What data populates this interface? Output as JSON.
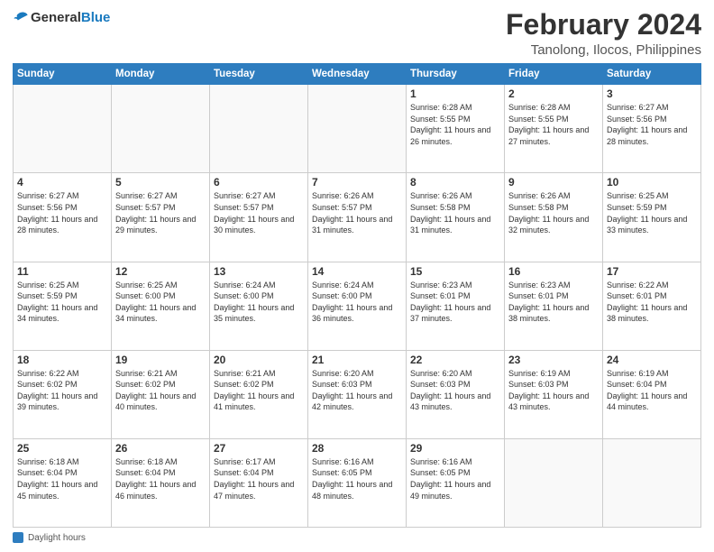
{
  "header": {
    "logo_general": "General",
    "logo_blue": "Blue",
    "title": "February 2024",
    "subtitle": "Tanolong, Ilocos, Philippines"
  },
  "days_of_week": [
    "Sunday",
    "Monday",
    "Tuesday",
    "Wednesday",
    "Thursday",
    "Friday",
    "Saturday"
  ],
  "weeks": [
    [
      {
        "day": "",
        "info": ""
      },
      {
        "day": "",
        "info": ""
      },
      {
        "day": "",
        "info": ""
      },
      {
        "day": "",
        "info": ""
      },
      {
        "day": "1",
        "info": "Sunrise: 6:28 AM\nSunset: 5:55 PM\nDaylight: 11 hours and 26 minutes."
      },
      {
        "day": "2",
        "info": "Sunrise: 6:28 AM\nSunset: 5:55 PM\nDaylight: 11 hours and 27 minutes."
      },
      {
        "day": "3",
        "info": "Sunrise: 6:27 AM\nSunset: 5:56 PM\nDaylight: 11 hours and 28 minutes."
      }
    ],
    [
      {
        "day": "4",
        "info": "Sunrise: 6:27 AM\nSunset: 5:56 PM\nDaylight: 11 hours and 28 minutes."
      },
      {
        "day": "5",
        "info": "Sunrise: 6:27 AM\nSunset: 5:57 PM\nDaylight: 11 hours and 29 minutes."
      },
      {
        "day": "6",
        "info": "Sunrise: 6:27 AM\nSunset: 5:57 PM\nDaylight: 11 hours and 30 minutes."
      },
      {
        "day": "7",
        "info": "Sunrise: 6:26 AM\nSunset: 5:57 PM\nDaylight: 11 hours and 31 minutes."
      },
      {
        "day": "8",
        "info": "Sunrise: 6:26 AM\nSunset: 5:58 PM\nDaylight: 11 hours and 31 minutes."
      },
      {
        "day": "9",
        "info": "Sunrise: 6:26 AM\nSunset: 5:58 PM\nDaylight: 11 hours and 32 minutes."
      },
      {
        "day": "10",
        "info": "Sunrise: 6:25 AM\nSunset: 5:59 PM\nDaylight: 11 hours and 33 minutes."
      }
    ],
    [
      {
        "day": "11",
        "info": "Sunrise: 6:25 AM\nSunset: 5:59 PM\nDaylight: 11 hours and 34 minutes."
      },
      {
        "day": "12",
        "info": "Sunrise: 6:25 AM\nSunset: 6:00 PM\nDaylight: 11 hours and 34 minutes."
      },
      {
        "day": "13",
        "info": "Sunrise: 6:24 AM\nSunset: 6:00 PM\nDaylight: 11 hours and 35 minutes."
      },
      {
        "day": "14",
        "info": "Sunrise: 6:24 AM\nSunset: 6:00 PM\nDaylight: 11 hours and 36 minutes."
      },
      {
        "day": "15",
        "info": "Sunrise: 6:23 AM\nSunset: 6:01 PM\nDaylight: 11 hours and 37 minutes."
      },
      {
        "day": "16",
        "info": "Sunrise: 6:23 AM\nSunset: 6:01 PM\nDaylight: 11 hours and 38 minutes."
      },
      {
        "day": "17",
        "info": "Sunrise: 6:22 AM\nSunset: 6:01 PM\nDaylight: 11 hours and 38 minutes."
      }
    ],
    [
      {
        "day": "18",
        "info": "Sunrise: 6:22 AM\nSunset: 6:02 PM\nDaylight: 11 hours and 39 minutes."
      },
      {
        "day": "19",
        "info": "Sunrise: 6:21 AM\nSunset: 6:02 PM\nDaylight: 11 hours and 40 minutes."
      },
      {
        "day": "20",
        "info": "Sunrise: 6:21 AM\nSunset: 6:02 PM\nDaylight: 11 hours and 41 minutes."
      },
      {
        "day": "21",
        "info": "Sunrise: 6:20 AM\nSunset: 6:03 PM\nDaylight: 11 hours and 42 minutes."
      },
      {
        "day": "22",
        "info": "Sunrise: 6:20 AM\nSunset: 6:03 PM\nDaylight: 11 hours and 43 minutes."
      },
      {
        "day": "23",
        "info": "Sunrise: 6:19 AM\nSunset: 6:03 PM\nDaylight: 11 hours and 43 minutes."
      },
      {
        "day": "24",
        "info": "Sunrise: 6:19 AM\nSunset: 6:04 PM\nDaylight: 11 hours and 44 minutes."
      }
    ],
    [
      {
        "day": "25",
        "info": "Sunrise: 6:18 AM\nSunset: 6:04 PM\nDaylight: 11 hours and 45 minutes."
      },
      {
        "day": "26",
        "info": "Sunrise: 6:18 AM\nSunset: 6:04 PM\nDaylight: 11 hours and 46 minutes."
      },
      {
        "day": "27",
        "info": "Sunrise: 6:17 AM\nSunset: 6:04 PM\nDaylight: 11 hours and 47 minutes."
      },
      {
        "day": "28",
        "info": "Sunrise: 6:16 AM\nSunset: 6:05 PM\nDaylight: 11 hours and 48 minutes."
      },
      {
        "day": "29",
        "info": "Sunrise: 6:16 AM\nSunset: 6:05 PM\nDaylight: 11 hours and 49 minutes."
      },
      {
        "day": "",
        "info": ""
      },
      {
        "day": "",
        "info": ""
      }
    ]
  ],
  "footer": {
    "label": "Daylight hours"
  }
}
